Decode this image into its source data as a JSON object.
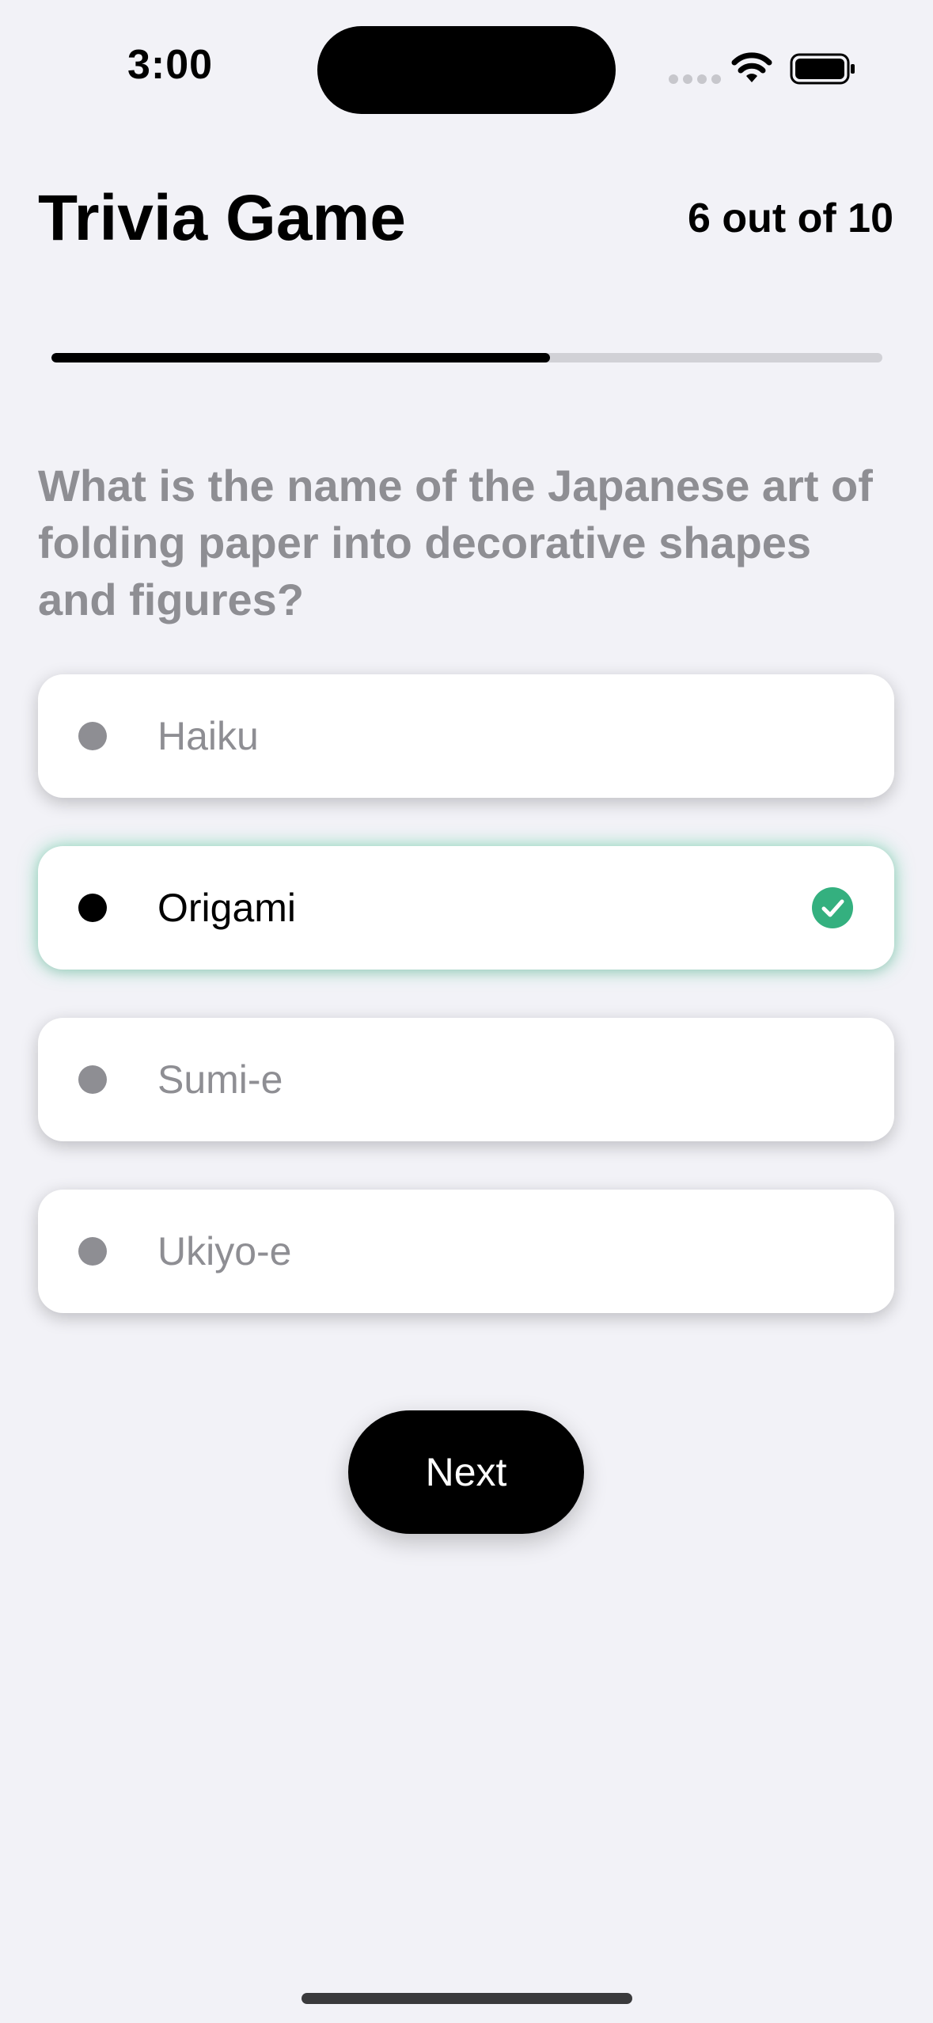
{
  "status_bar": {
    "time": "3:00"
  },
  "header": {
    "title": "Trivia Game",
    "counter": "6 out of 10"
  },
  "progress": {
    "fraction": 0.6,
    "fill_color": "#000000",
    "track_color": "#d1d1d6"
  },
  "question": {
    "text": "What is the name of the Japanese art of folding paper into decorative shapes and figures?"
  },
  "options": [
    {
      "label": "Haiku",
      "selected": false
    },
    {
      "label": "Origami",
      "selected": true
    },
    {
      "label": "Sumi-e",
      "selected": false
    },
    {
      "label": "Ukiyo-e",
      "selected": false
    }
  ],
  "next_button": {
    "label": "Next"
  },
  "colors": {
    "background": "#f2f2f7",
    "correct": "#34b07f",
    "muted_text": "#8e8e93"
  },
  "icons": {
    "selected_indicator": "checkmark-circle-icon",
    "status": [
      "cellular-signal-icon",
      "wifi-icon",
      "battery-icon"
    ]
  }
}
